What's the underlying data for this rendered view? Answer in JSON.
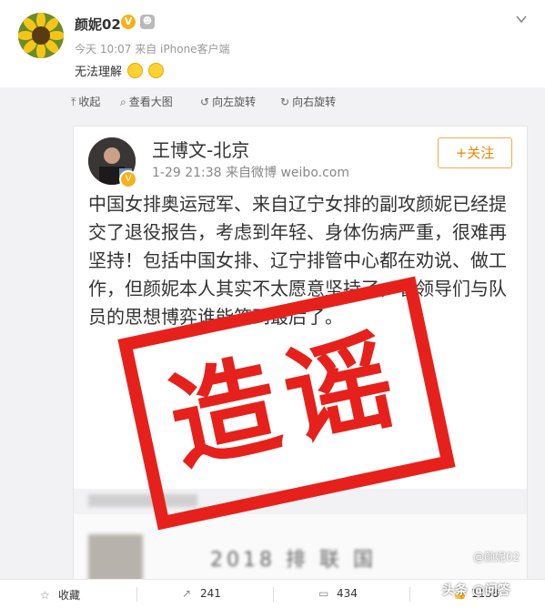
{
  "post": {
    "username": "颜妮02",
    "verified_mark": "V",
    "timestamp": "今天 10:07",
    "source": "来自 iPhone客户端",
    "text": "无法理解"
  },
  "toolbar": {
    "collapse": "收起",
    "view_large": "查看大图",
    "rotate_left": "向左旋转",
    "rotate_right": "向右旋转"
  },
  "repost": {
    "author": "王博文-北京",
    "timestamp": "1-29 21:38",
    "source": "来自微博 weibo.com",
    "follow_label": "+关注",
    "body": "中国女排奥运冠军、来自辽宁女排的副攻颜妮已经提交了退役报告，考虑到年轻、身体伤病严重，很难再坚持！包括中国女排、辽宁排管中心都在劝说、做工作，但颜妮本人其实不太愿意坚持了，看领导们与队员的思想博弈谁能笑到最后了。",
    "blurred_text": "2018 排 联 国"
  },
  "stamp": {
    "text": "造谣",
    "color": "#e6211b"
  },
  "watermark": "@颜妮02",
  "footer": {
    "favorite": "收藏",
    "forward_count": "241",
    "comment_count": "434",
    "like_count": "1138",
    "logo": "头条 @问答"
  },
  "colors": {
    "accent": "#f08300",
    "follow_border": "#f7a94a",
    "verified": "#f4b21b"
  },
  "icons": [
    "chevron-down-icon",
    "collapse-icon",
    "zoom-icon",
    "rotate-left-icon",
    "rotate-right-icon",
    "star-icon",
    "forward-icon",
    "comment-icon",
    "like-icon"
  ]
}
